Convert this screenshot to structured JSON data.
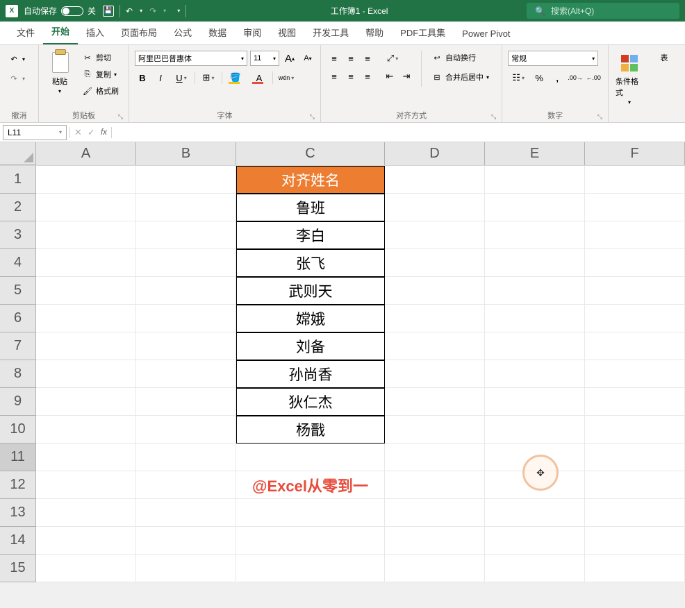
{
  "title_bar": {
    "autosave_label": "自动保存",
    "autosave_state": "关",
    "undo_icon": "↶",
    "redo_icon": "↷",
    "doc_title": "工作簿1  -  Excel",
    "search_placeholder": "搜索(Alt+Q)"
  },
  "menu": {
    "items": [
      "文件",
      "开始",
      "插入",
      "页面布局",
      "公式",
      "数据",
      "审阅",
      "视图",
      "开发工具",
      "帮助",
      "PDF工具集",
      "Power Pivot"
    ],
    "active_index": 1
  },
  "ribbon": {
    "undo": {
      "label": "撤消"
    },
    "clipboard": {
      "paste": "粘贴",
      "cut": "剪切",
      "copy": "复制",
      "format_painter": "格式刷",
      "label": "剪贴板"
    },
    "font": {
      "name": "阿里巴巴普惠体",
      "size": "11",
      "increase": "A",
      "decrease": "A",
      "bold": "B",
      "italic": "I",
      "underline": "U",
      "phonetic": "wén",
      "label": "字体"
    },
    "alignment": {
      "wrap": "自动换行",
      "merge": "合并后居中",
      "label": "对齐方式"
    },
    "number": {
      "format": "常规",
      "label": "数字"
    },
    "styles": {
      "cond_format": "条件格式",
      "table": "表"
    }
  },
  "formula_bar": {
    "name_box": "L11",
    "fx": "fx"
  },
  "grid": {
    "columns": [
      "A",
      "B",
      "C",
      "D",
      "E",
      "F"
    ],
    "row_count": 15,
    "data": {
      "header": "对齐姓名",
      "names": [
        "鲁班",
        "李白",
        "张飞",
        "武则天",
        "嫦娥",
        "刘备",
        "孙尚香",
        "狄仁杰",
        "杨戬"
      ],
      "watermark": "@Excel从零到一"
    }
  }
}
